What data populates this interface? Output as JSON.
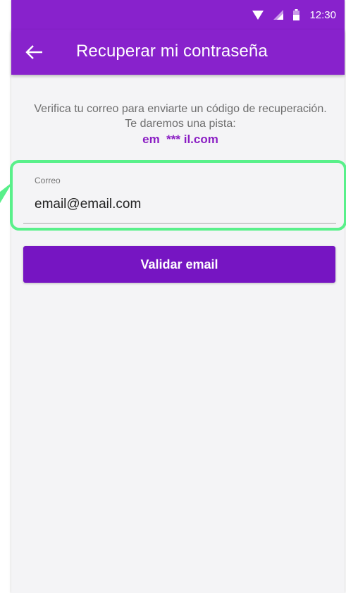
{
  "status_bar": {
    "time": "12:30",
    "icons": [
      "wifi-icon",
      "signal-icon",
      "battery-icon"
    ]
  },
  "app_bar": {
    "back_icon": "arrow-left-icon",
    "title": "Recuperar mi contraseña"
  },
  "main": {
    "info_text": "Verifica tu correo para enviarte un código de recuperación. Te daremos una pista:",
    "hint": "em  *** il.com"
  },
  "email_input": {
    "label": "Correo",
    "value": "email@email.com"
  },
  "validate_button": {
    "label": "Validar email"
  },
  "colors": {
    "primary": "#8822cc",
    "button": "#7615c2",
    "hint": "#8b1fc4",
    "highlight": "#59f08a",
    "background": "#f4f4f6"
  }
}
